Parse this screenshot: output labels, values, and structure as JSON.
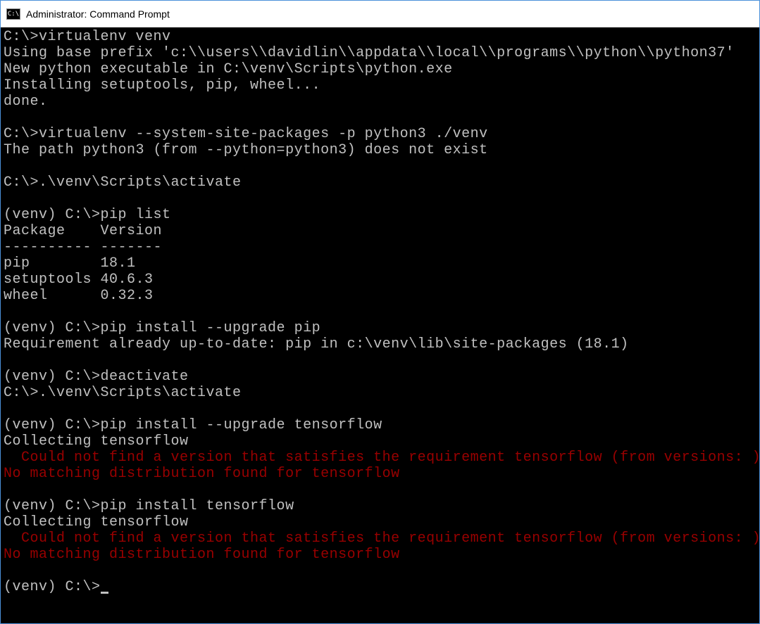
{
  "titlebar": {
    "icon_text": "C:\\",
    "title": "Administrator: Command Prompt"
  },
  "terminal": {
    "lines": [
      {
        "text": "C:\\>virtualenv venv",
        "error": false
      },
      {
        "text": "Using base prefix 'c:\\\\users\\\\davidlin\\\\appdata\\\\local\\\\programs\\\\python\\\\python37'",
        "error": false
      },
      {
        "text": "New python executable in C:\\venv\\Scripts\\python.exe",
        "error": false
      },
      {
        "text": "Installing setuptools, pip, wheel...",
        "error": false
      },
      {
        "text": "done.",
        "error": false
      },
      {
        "text": "",
        "error": false
      },
      {
        "text": "C:\\>virtualenv --system-site-packages -p python3 ./venv",
        "error": false
      },
      {
        "text": "The path python3 (from --python=python3) does not exist",
        "error": false
      },
      {
        "text": "",
        "error": false
      },
      {
        "text": "C:\\>.\\venv\\Scripts\\activate",
        "error": false
      },
      {
        "text": "",
        "error": false
      },
      {
        "text": "(venv) C:\\>pip list",
        "error": false
      },
      {
        "text": "Package    Version",
        "error": false
      },
      {
        "text": "---------- -------",
        "error": false
      },
      {
        "text": "pip        18.1",
        "error": false
      },
      {
        "text": "setuptools 40.6.3",
        "error": false
      },
      {
        "text": "wheel      0.32.3",
        "error": false
      },
      {
        "text": "",
        "error": false
      },
      {
        "text": "(venv) C:\\>pip install --upgrade pip",
        "error": false
      },
      {
        "text": "Requirement already up-to-date: pip in c:\\venv\\lib\\site-packages (18.1)",
        "error": false
      },
      {
        "text": "",
        "error": false
      },
      {
        "text": "(venv) C:\\>deactivate",
        "error": false
      },
      {
        "text": "C:\\>.\\venv\\Scripts\\activate",
        "error": false
      },
      {
        "text": "",
        "error": false
      },
      {
        "text": "(venv) C:\\>pip install --upgrade tensorflow",
        "error": false
      },
      {
        "text": "Collecting tensorflow",
        "error": false
      },
      {
        "text": "  Could not find a version that satisfies the requirement tensorflow (from versions: )",
        "error": true
      },
      {
        "text": "No matching distribution found for tensorflow",
        "error": true
      },
      {
        "text": "",
        "error": false
      },
      {
        "text": "(venv) C:\\>pip install tensorflow",
        "error": false
      },
      {
        "text": "Collecting tensorflow",
        "error": false
      },
      {
        "text": "  Could not find a version that satisfies the requirement tensorflow (from versions: )",
        "error": true
      },
      {
        "text": "No matching distribution found for tensorflow",
        "error": true
      },
      {
        "text": "",
        "error": false
      }
    ],
    "prompt": "(venv) C:\\>"
  }
}
